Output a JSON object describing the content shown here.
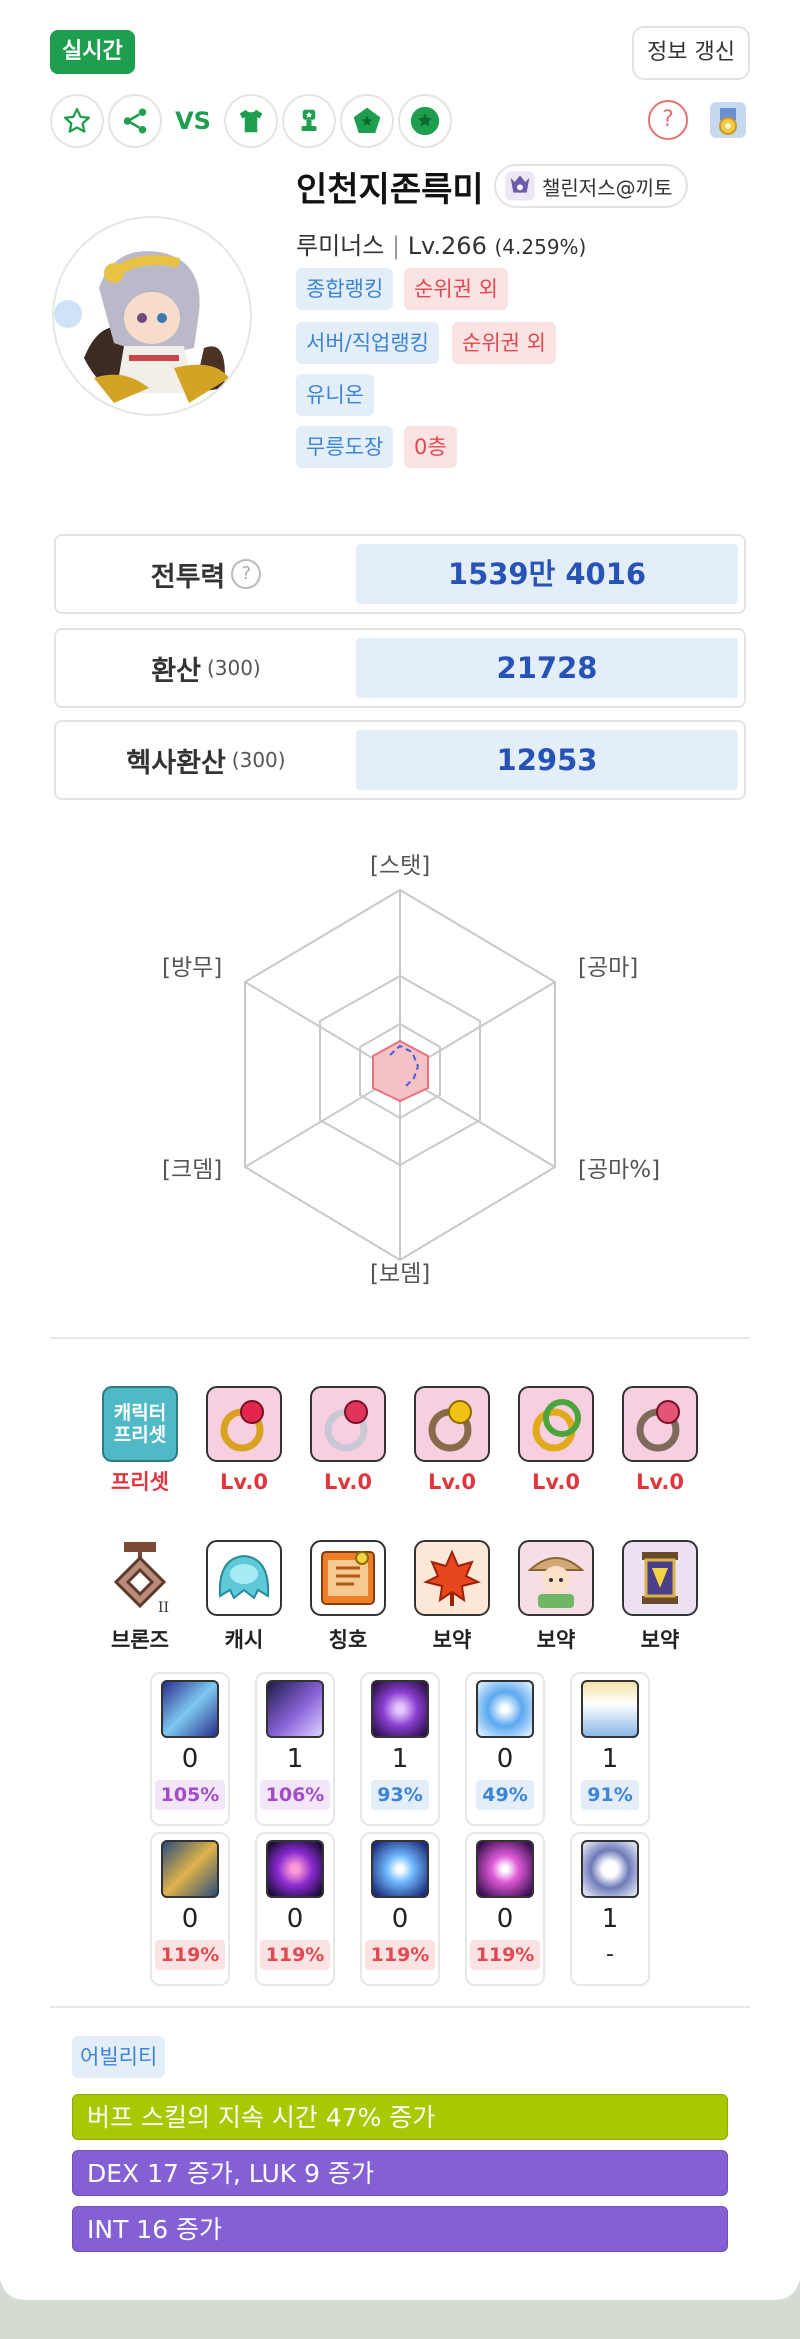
{
  "header": {
    "live_label": "실시간",
    "refresh_label": "정보 갱신",
    "vs_label": "VS"
  },
  "profile": {
    "name": "인천지존륵미",
    "guild": "챌린저스@끼토",
    "class": "루미너스",
    "level": "Lv.266",
    "exp": "(4.259%)",
    "rankings": [
      {
        "label": "종합랭킹",
        "value": "순위권 외"
      },
      {
        "label": "서버/직업랭킹",
        "value": "순위권 외"
      },
      {
        "label": "유니온",
        "value": ""
      },
      {
        "label": "무릉도장",
        "value": "0층"
      }
    ]
  },
  "stats": [
    {
      "label": "전투력",
      "sub": "",
      "value": "1539만 4016"
    },
    {
      "label": "환산",
      "sub": "(300)",
      "value": "21728"
    },
    {
      "label": "헥사환산",
      "sub": "(300)",
      "value": "12953"
    }
  ],
  "radar": {
    "labels": {
      "top": "[스탯]",
      "top_right": "[공마]",
      "bottom_right": "[공마%]",
      "bottom": "[보뎀]",
      "bottom_left": "[크뎀]",
      "top_left": "[방무]"
    }
  },
  "equipment_row1": [
    {
      "name": "preset-icon",
      "label": "프리셋",
      "preset_text": "캐릭터 프리셋"
    },
    {
      "name": "ring-ruby-icon",
      "label": "Lv.0"
    },
    {
      "name": "ring-pink-icon",
      "label": "Lv.0"
    },
    {
      "name": "ring-gold-icon",
      "label": "Lv.0"
    },
    {
      "name": "ring-green-icon",
      "label": "Lv.0"
    },
    {
      "name": "ring-silver-icon",
      "label": "Lv.0"
    }
  ],
  "equipment_row2": [
    {
      "name": "bronze-emblem-icon",
      "label": "브론즈"
    },
    {
      "name": "cash-item-icon",
      "label": "캐시"
    },
    {
      "name": "title-item-icon",
      "label": "칭호"
    },
    {
      "name": "leaf-potion-icon",
      "label": "보약"
    },
    {
      "name": "portrait-potion-icon",
      "label": "보약"
    },
    {
      "name": "lantern-potion-icon",
      "label": "보약"
    }
  ],
  "skills_row1": [
    {
      "count": "0",
      "pct": "105%",
      "tone": "purple"
    },
    {
      "count": "1",
      "pct": "106%",
      "tone": "purple"
    },
    {
      "count": "1",
      "pct": "93%",
      "tone": "blue"
    },
    {
      "count": "0",
      "pct": "49%",
      "tone": "blue"
    },
    {
      "count": "1",
      "pct": "91%",
      "tone": "blue"
    }
  ],
  "skills_row2": [
    {
      "count": "0",
      "pct": "119%",
      "tone": "red"
    },
    {
      "count": "0",
      "pct": "119%",
      "tone": "red"
    },
    {
      "count": "0",
      "pct": "119%",
      "tone": "red"
    },
    {
      "count": "0",
      "pct": "119%",
      "tone": "red"
    },
    {
      "count": "1",
      "pct": "-",
      "tone": "none"
    }
  ],
  "ability": {
    "title": "어빌리티",
    "lines": [
      {
        "text": "버프 스킬의 지속 시간 47% 증가",
        "color": "#a7c900"
      },
      {
        "text": "DEX 17 증가, LUK 9 증가",
        "color": "#8460d4"
      },
      {
        "text": "INT 16 증가",
        "color": "#8460d4"
      }
    ]
  }
}
